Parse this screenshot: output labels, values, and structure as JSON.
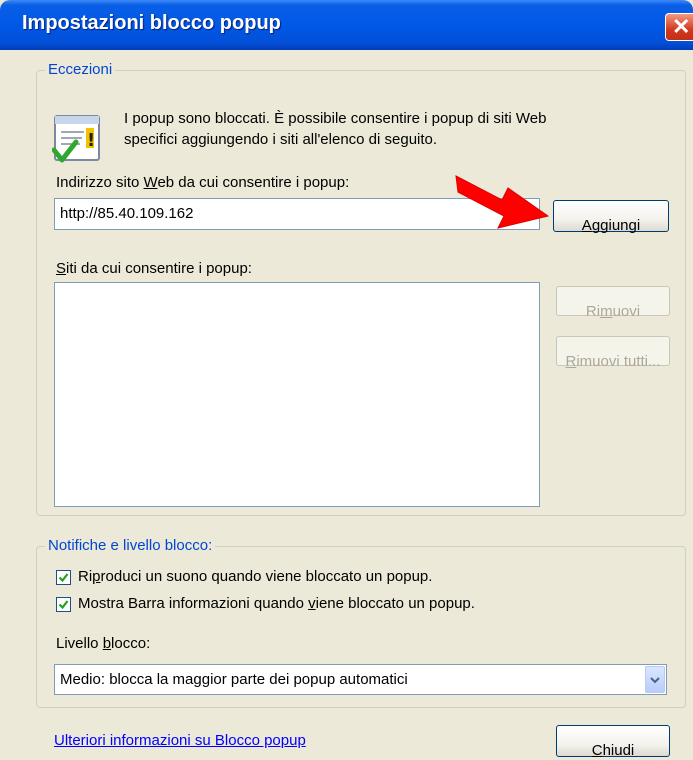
{
  "window": {
    "title": "Impostazioni blocco popup"
  },
  "eccezioni": {
    "legend": "Eccezioni",
    "info_line1": "I popup sono bloccati. È possibile consentire i popup di siti Web",
    "info_line2": "specifici aggiungendo i siti all'elenco di seguito.",
    "address_label_pre": "Indirizzo sito ",
    "address_label_key": "W",
    "address_label_post": "eb da cui consentire i popup:",
    "address_value": "http://85.40.109.162",
    "add_pre": "",
    "add_key": "A",
    "add_post": "ggiungi",
    "list_label_key": "S",
    "list_label_post": "iti da cui consentire i popup:",
    "remove_pre": "Ri",
    "remove_key": "m",
    "remove_post": "uovi",
    "remove_all_pre": "",
    "remove_all_key": "R",
    "remove_all_post": "imuovi tutti...",
    "allowed_sites": []
  },
  "notifiche": {
    "legend": "Notifiche e livello blocco:",
    "sound_pre": "Ri",
    "sound_key": "p",
    "sound_post": "roduci un suono quando viene bloccato un popup.",
    "sound_checked": true,
    "infobar_pre": "Mostra Barra informazioni quando ",
    "infobar_key": "v",
    "infobar_post": "iene bloccato un popup.",
    "infobar_checked": true,
    "level_label_pre": "Livello ",
    "level_label_key": "b",
    "level_label_post": "locco:",
    "level_value": "Medio: blocca la maggior parte dei popup automatici"
  },
  "footer": {
    "link": "Ulteriori informazioni su Blocco popup",
    "close_key": "C",
    "close_post": "hiudi"
  },
  "colors": {
    "titlebar": "#0058e6",
    "legend_text": "#0046d5",
    "arrow": "#ff0000",
    "link": "#0000ff",
    "dialog_bg": "#ece9d8"
  }
}
